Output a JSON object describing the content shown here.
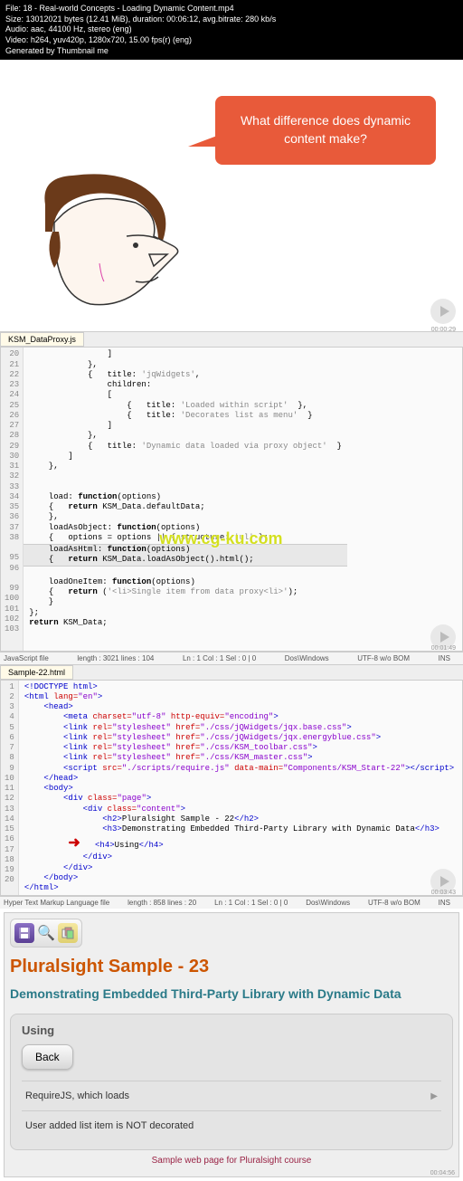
{
  "meta": {
    "file": "File: 18 - Real-world Concepts - Loading Dynamic Content.mp4",
    "size": "Size: 13012021 bytes (12.41 MiB), duration: 00:06:12, avg.bitrate: 280 kb/s",
    "audio": "Audio: aac, 44100 Hz, stereo (eng)",
    "video": "Video: h264, yuv420p, 1280x720, 15.00 fps(r) (eng)",
    "gen": "Generated by Thumbnail me"
  },
  "panel1": {
    "speech": "What difference does dynamic content make?",
    "timecode": "00:00:29"
  },
  "editor1": {
    "tab": "KSM_DataProxy.js",
    "lines_start": 20,
    "watermark": "www.cg-ku.com",
    "status": {
      "type": "JavaScript file",
      "length": "length : 3021   lines : 104",
      "pos": "Ln : 1   Col : 1   Sel : 0 | 0",
      "os": "Dos\\Windows",
      "enc": "UTF-8 w/o BOM",
      "ins": "INS"
    },
    "code": [
      "                ]",
      "            },",
      "            {   title: 'jqWidgets',",
      "                children:",
      "                [",
      "                    {   title: 'Loaded within script'  },",
      "                    {   title: 'Decorates list as menu'  }",
      "                ]",
      "            },",
      "            {   title: 'Dynamic data loaded via proxy object'  }",
      "        ]",
      "    },",
      "",
      "",
      "    load: function(options)",
      "    {   return KSM_Data.defaultData;",
      "    },",
      "    loadAsObject: function(options)",
      "    {   options = options || { structure: 'ul' };",
      "",
      "    loadAsHtml: function(options)",
      "    {   return KSM_Data.loadAsObject().html();",
      "",
      "    loadOneItem: function(options)",
      "    {   return ('<li>Single item from data proxy<li>');",
      "    }",
      "};",
      "return KSM_Data;"
    ],
    "timecode": "00:01:49"
  },
  "editor2": {
    "tab": "Sample-22.html",
    "status": {
      "type": "Hyper Text Markup Language file",
      "length": "length : 858   lines : 20",
      "pos": "Ln : 1   Col : 1   Sel : 0 | 0",
      "os": "Dos\\Windows",
      "enc": "UTF-8 w/o BOM",
      "ins": "INS"
    },
    "timecode": "00:03:43"
  },
  "panel3": {
    "title": "Pluralsight Sample - 23",
    "subtitle": "Demonstrating Embedded Third-Party Library with Dynamic Data",
    "using": "Using",
    "back": "Back",
    "row1": "RequireJS, which loads",
    "row2": "User added list item is NOT decorated",
    "footer": "Sample web page for Pluralsight course",
    "timecode": "00:04:56"
  }
}
